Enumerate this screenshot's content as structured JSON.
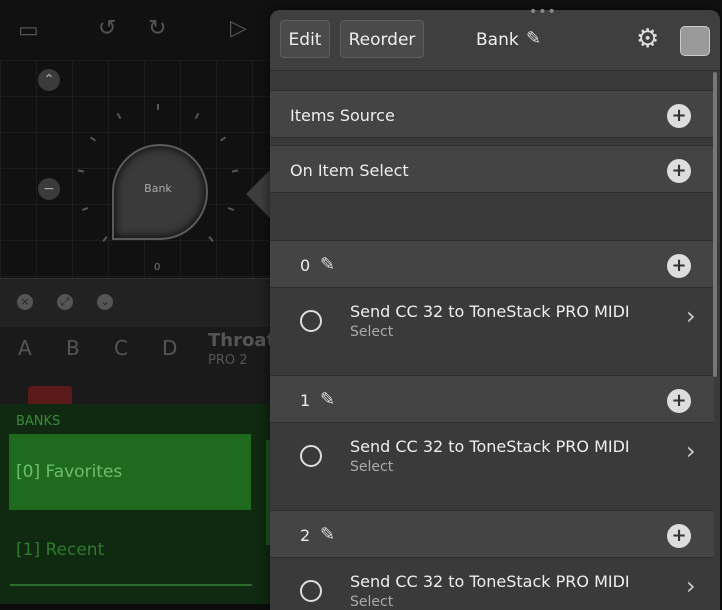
{
  "background": {
    "knob_label": "Bank",
    "knob_value": "0",
    "tabs": [
      "A",
      "B",
      "C",
      "D"
    ],
    "preset_title": "Throat",
    "preset_subtitle": "PRO 2",
    "banks_label": "BANKS",
    "banks": [
      "[0] Favorites",
      "[1] Recent"
    ]
  },
  "popover": {
    "edit_label": "Edit",
    "reorder_label": "Reorder",
    "title": "Bank",
    "sections": [
      {
        "label": "Items Source"
      },
      {
        "label": "On Item Select"
      }
    ],
    "items": [
      {
        "index": "0",
        "title": "Send CC 32 to ToneStack PRO MIDI",
        "subtitle": "Select"
      },
      {
        "index": "1",
        "title": "Send CC 32 to ToneStack PRO MIDI",
        "subtitle": "Select"
      },
      {
        "index": "2",
        "title": "Send CC 32 to ToneStack PRO MIDI",
        "subtitle": "Select"
      }
    ]
  },
  "icons": {
    "grip": "•••",
    "pencil": "✎",
    "gear": "⚙",
    "plus": "+",
    "chevron": "›"
  }
}
